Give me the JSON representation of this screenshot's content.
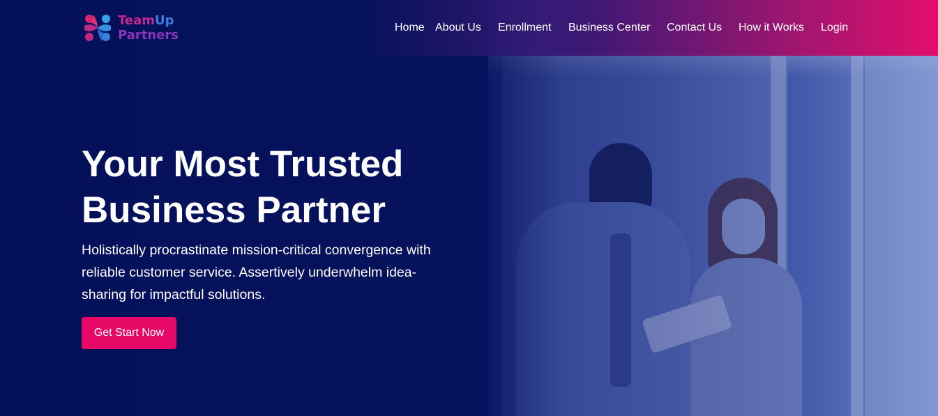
{
  "brand": {
    "name_part1": "Team",
    "name_part2": "Up",
    "name_line2": "Partners"
  },
  "nav": {
    "items": [
      "Home",
      "About Us",
      "Enrollment",
      "Business Center",
      "Contact Us",
      "How it Works",
      "Login"
    ]
  },
  "hero": {
    "title_line1": "Your Most Trusted",
    "title_line2": "Business Partner",
    "description": "Holistically procrastinate mission-critical convergence with reliable customer service. Assertively underwhelm idea-sharing for impactful solutions.",
    "cta_label": "Get Start Now"
  },
  "colors": {
    "background": "#06125c",
    "accent": "#e60a66",
    "header_gradient_end": "#e30e6e"
  },
  "icons": {
    "logo": "teamup-partners-logo"
  }
}
